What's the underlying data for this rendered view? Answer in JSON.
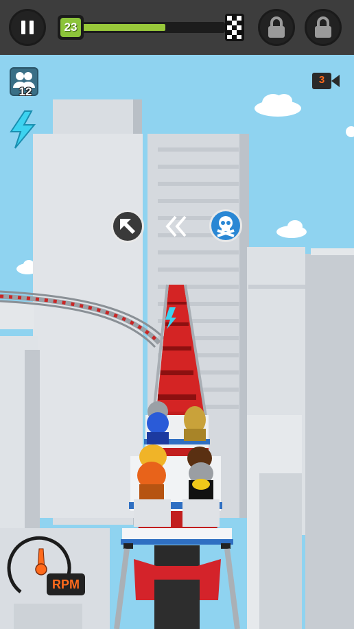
{
  "hud": {
    "level": "23",
    "progress": 0.62,
    "passengers_count": "12",
    "camera_count": "3",
    "rpm_label": "RPM",
    "rpm_level": 0.5
  },
  "icons": {
    "pause": "pause-icon",
    "lock": "lock-icon",
    "finish": "checkered-flag-icon",
    "passengers": "people-icon",
    "boost": "lightning-icon",
    "camera": "video-camera-icon",
    "turn": "arrow-up-left-icon",
    "back": "double-chevron-left-icon",
    "danger": "skull-crossbones-icon"
  },
  "colors": {
    "sky": "#8fd3f0",
    "hud_bar": "#3d3d3d",
    "progress_fill": "#98c83a",
    "track_red": "#d42424",
    "skull_blue": "#2a87d4",
    "rpm_orange": "#ff6a1c",
    "boost_cyan": "#3dd3f0"
  }
}
